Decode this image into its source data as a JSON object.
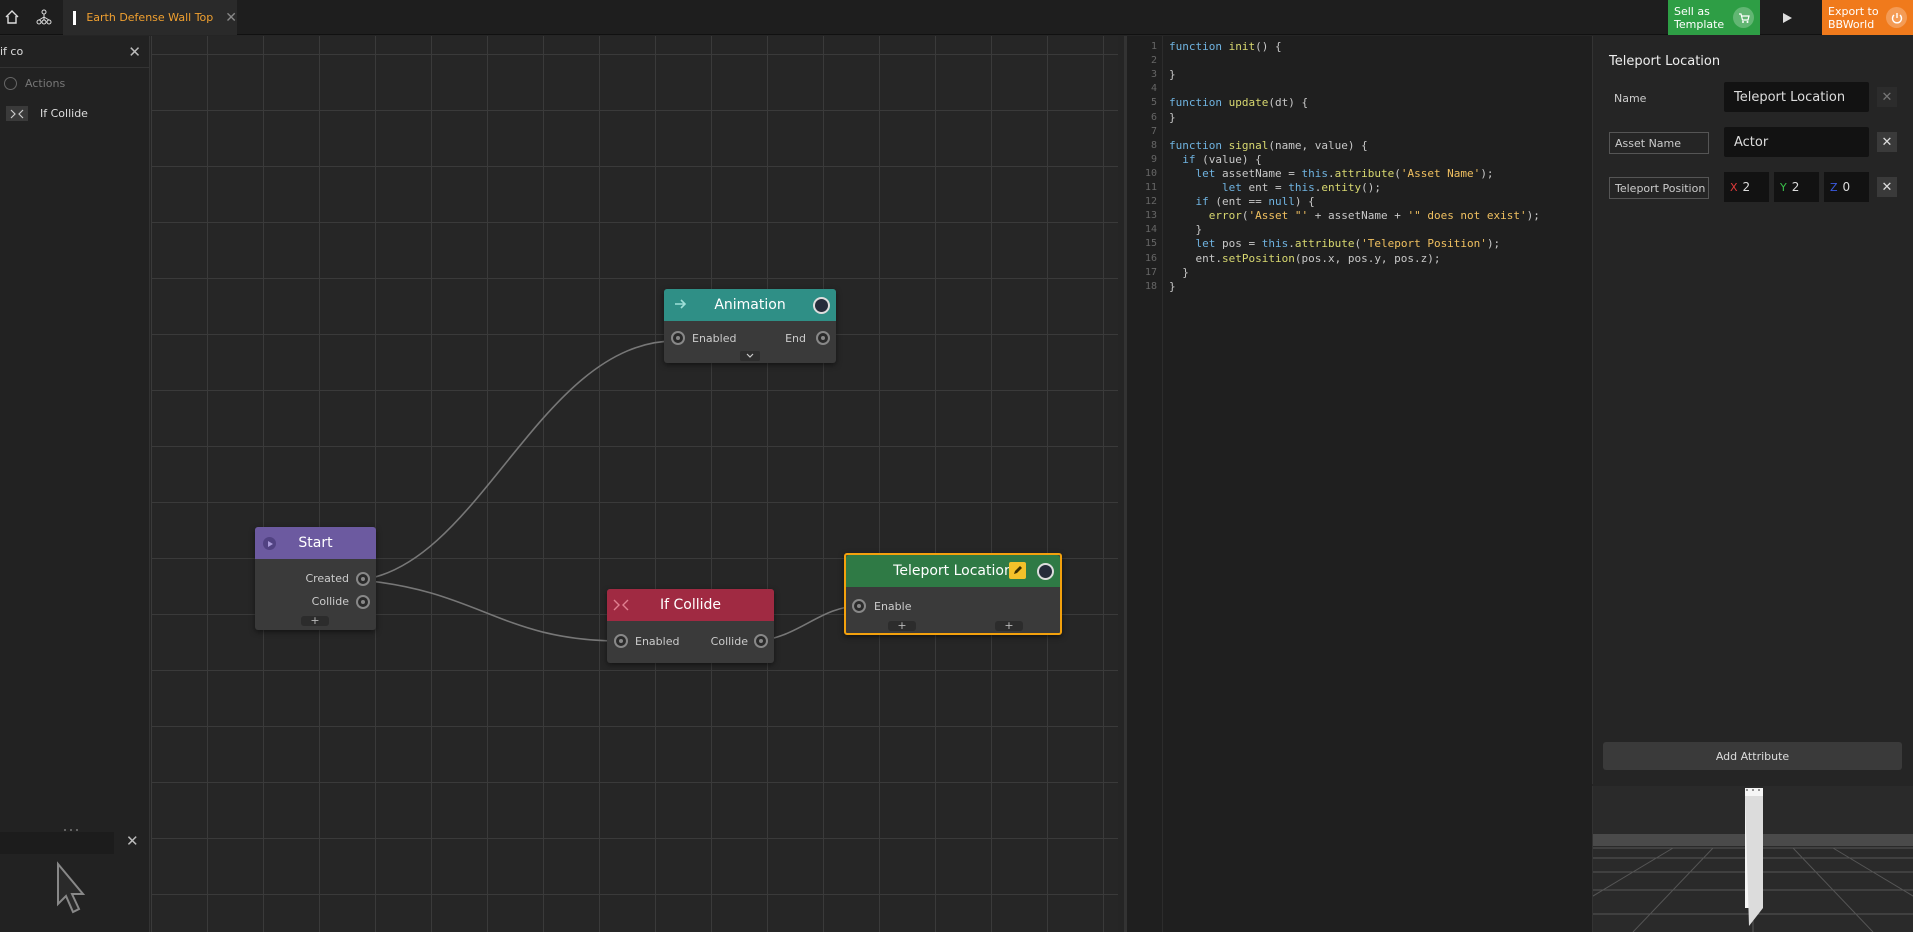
{
  "topbar": {
    "document_tab": "Earth Defense Wall Top",
    "sell_button": [
      "Sell as",
      "Template"
    ],
    "export_button": [
      "Export to",
      "BBWorld"
    ]
  },
  "left_panel": {
    "search_value": "if co",
    "category": "Actions",
    "items": [
      {
        "label": "If Collide",
        "icon": "collide-icon"
      }
    ]
  },
  "nodes": {
    "animation": {
      "title": "Animation",
      "inputs": [
        "Enabled"
      ],
      "outputs": [
        "End"
      ],
      "color": "#2f8f86"
    },
    "start": {
      "title": "Start",
      "outputs": [
        "Created",
        "Collide"
      ],
      "color": "#6c5aa0"
    },
    "if_collide": {
      "title": "If Collide",
      "inputs": [
        "Enabled"
      ],
      "outputs": [
        "Collide"
      ],
      "color": "#a02a42"
    },
    "teleport": {
      "title": "Teleport Location",
      "inputs": [
        "Enable"
      ],
      "color": "#2f7a45",
      "selected_border": "#f3a10d"
    }
  },
  "code": {
    "lines": [
      "function init() {",
      "",
      "}",
      "",
      "function update(dt) {",
      "}",
      "",
      "function signal(name, value) {",
      "  if (value) {",
      "    let assetName = this.attribute('Asset Name');",
      "        let ent = this.entity();",
      "    if (ent == null) {",
      "      error('Asset \"' + assetName + '\" does not exist');",
      "    }",
      "    let pos = this.attribute('Teleport Position');",
      "    ent.setPosition(pos.x, pos.y, pos.z);",
      "  }",
      "}"
    ]
  },
  "properties": {
    "title": "Teleport Location",
    "rows": [
      {
        "name": "Name",
        "value": "Teleport Location"
      },
      {
        "name": "Asset Name",
        "value": "Actor"
      },
      {
        "name": "Teleport Position",
        "x_label": "X",
        "x": "2",
        "y_label": "Y",
        "y": "2",
        "z_label": "Z",
        "z": "0"
      }
    ],
    "add_button": "Add Attribute"
  },
  "colors": {
    "accent_orange": "#f07a1c",
    "sell_green": "#2e9e45",
    "tab_text": "#f0a030",
    "code_keyword": "#6fb3e0",
    "code_function": "#d8d870",
    "code_string": "#f0c060"
  }
}
